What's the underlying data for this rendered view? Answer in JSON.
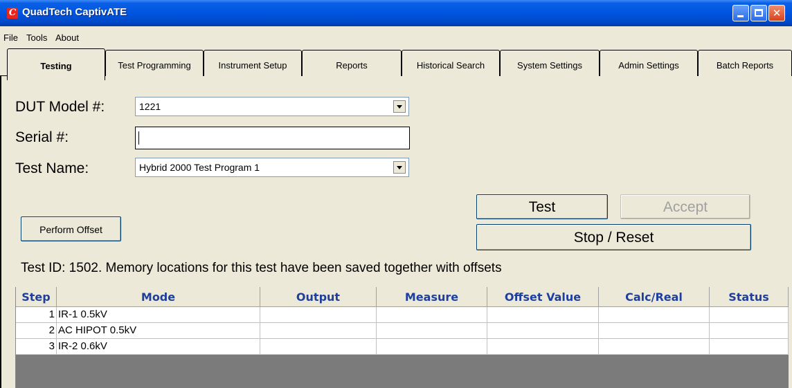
{
  "window": {
    "title": "QuadTech CaptivATE",
    "icon": "app-logo-icon",
    "close_glyph": "✕"
  },
  "menu": [
    "File",
    "Tools",
    "About"
  ],
  "tabs": [
    "Testing",
    "Test Programming",
    "Instrument Setup",
    "Reports",
    "Historical Search",
    "System Settings",
    "Admin Settings",
    "Batch Reports"
  ],
  "active_tab": "Testing",
  "form": {
    "dut_label": "DUT Model #:",
    "dut_value": "1221",
    "serial_label": "Serial #:",
    "serial_value": "",
    "test_name_label": "Test Name:",
    "test_name_value": "Hybrid 2000 Test Program 1"
  },
  "buttons": {
    "perform_offset": "Perform Offset",
    "test": "Test",
    "accept": "Accept",
    "stop_reset": "Stop / Reset"
  },
  "test_id_text": "Test ID: 1502. Memory locations for this test have been saved together with offsets",
  "table": {
    "columns": [
      "Step",
      "Mode",
      "Output",
      "Measure",
      "Offset Value",
      "Calc/Real",
      "Status"
    ],
    "rows": [
      [
        "1",
        "IR-1 0.5kV",
        "",
        "",
        "",
        "",
        ""
      ],
      [
        "2",
        "AC HIPOT 0.5kV",
        "",
        "",
        "",
        "",
        ""
      ],
      [
        "3",
        "IR-2 0.6kV",
        "",
        "",
        "",
        "",
        ""
      ]
    ]
  },
  "colors": {
    "title_bar": "#0055e0",
    "header_text": "#1e3f9e",
    "grid_background": "#7b7b7b",
    "disabled_text": "#a0a0a0"
  }
}
